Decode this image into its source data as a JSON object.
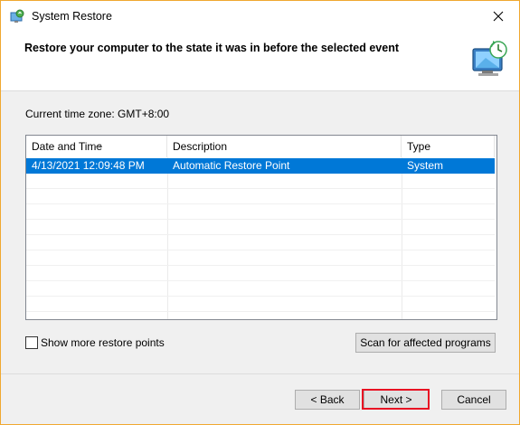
{
  "window": {
    "title": "System Restore",
    "header": "Restore your computer to the state it was in before the selected event",
    "accent_color": "#f0a830"
  },
  "timezone": "Current time zone: GMT+8:00",
  "table": {
    "columns": [
      "Date and Time",
      "Description",
      "Type"
    ],
    "rows": [
      {
        "date": "4/13/2021 12:09:48 PM",
        "description": "Automatic Restore Point",
        "type": "System",
        "selected": true
      }
    ],
    "selection_color": "#0078d7"
  },
  "options": {
    "show_more_label": "Show more restore points",
    "show_more_checked": false,
    "scan_label": "Scan for affected programs"
  },
  "footer": {
    "back_label": "< Back",
    "next_label": "Next >",
    "cancel_label": "Cancel",
    "highlight_color": "#e81123"
  },
  "icons": [
    "system-restore-icon",
    "close-icon",
    "restore-computer-icon",
    "sort-arrow-icon"
  ]
}
